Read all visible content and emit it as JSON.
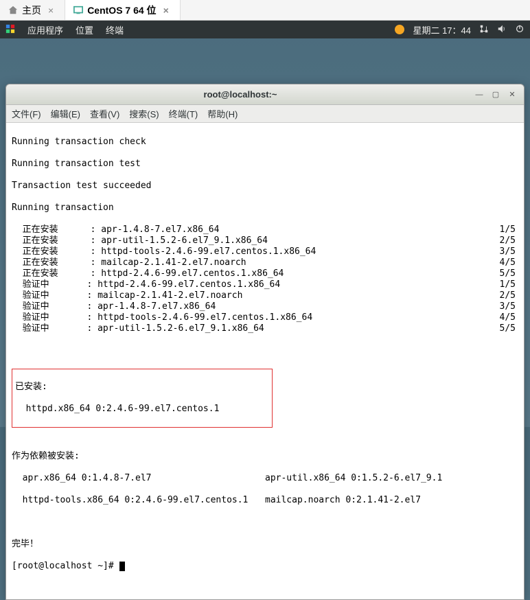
{
  "vmTabs": {
    "home": "主页",
    "active": "CentOS 7 64 位"
  },
  "topbar": {
    "apps": "应用程序",
    "places": "位置",
    "terminal": "终端",
    "datetime": "星期二 17：44"
  },
  "window": {
    "title": "root@localhost:~"
  },
  "menu": {
    "file": "文件(F)",
    "edit": "编辑(E)",
    "view": "查看(V)",
    "search": "搜索(S)",
    "terminal": "终端(T)",
    "help": "帮助(H)"
  },
  "term": {
    "run_check": "Running transaction check",
    "run_test": "Running transaction test",
    "test_ok": "Transaction test succeeded",
    "run_tx": "Running transaction",
    "installing": "正在安装",
    "verifying": "验证中",
    "install_lines": [
      {
        "label": "正在安装",
        "pkg": "apr-1.4.8-7.el7.x86_64",
        "n": "1/5"
      },
      {
        "label": "正在安装",
        "pkg": "apr-util-1.5.2-6.el7_9.1.x86_64",
        "n": "2/5"
      },
      {
        "label": "正在安装",
        "pkg": "httpd-tools-2.4.6-99.el7.centos.1.x86_64",
        "n": "3/5"
      },
      {
        "label": "正在安装",
        "pkg": "mailcap-2.1.41-2.el7.noarch",
        "n": "4/5"
      },
      {
        "label": "正在安装",
        "pkg": "httpd-2.4.6-99.el7.centos.1.x86_64",
        "n": "5/5"
      },
      {
        "label": "验证中",
        "pkg": "httpd-2.4.6-99.el7.centos.1.x86_64",
        "n": "1/5"
      },
      {
        "label": "验证中",
        "pkg": "mailcap-2.1.41-2.el7.noarch",
        "n": "2/5"
      },
      {
        "label": "验证中",
        "pkg": "apr-1.4.8-7.el7.x86_64",
        "n": "3/5"
      },
      {
        "label": "验证中",
        "pkg": "httpd-tools-2.4.6-99.el7.centos.1.x86_64",
        "n": "4/5"
      },
      {
        "label": "验证中",
        "pkg": "apr-util-1.5.2-6.el7_9.1.x86_64",
        "n": "5/5"
      }
    ],
    "installed_header": "已安装:",
    "installed_line": "  httpd.x86_64 0:2.4.6-99.el7.centos.1",
    "deps_header": "作为依赖被安装:",
    "deps_left1": "  apr.x86_64 0:1.4.8-7.el7",
    "deps_right1": "apr-util.x86_64 0:1.5.2-6.el7_9.1",
    "deps_left2": "  httpd-tools.x86_64 0:2.4.6-99.el7.centos.1",
    "deps_right2": "mailcap.noarch 0:2.1.41-2.el7",
    "done": "完毕！",
    "prompt": "[root@localhost ~]# "
  }
}
